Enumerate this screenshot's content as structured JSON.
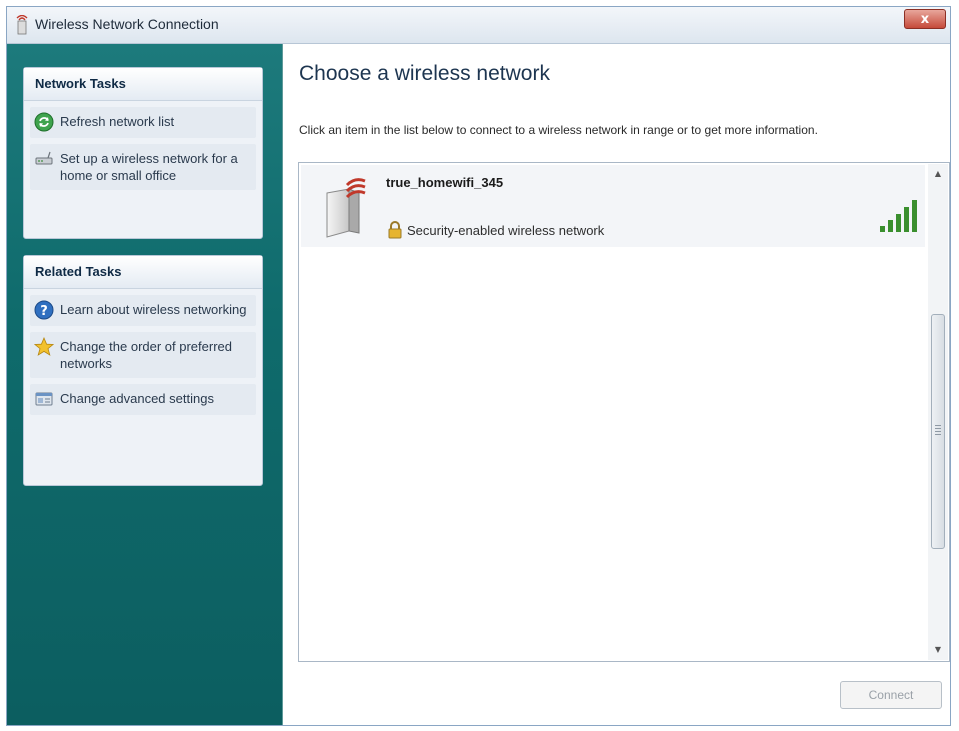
{
  "window": {
    "title": "Wireless Network Connection",
    "close_label": "x"
  },
  "sidebar": {
    "network_tasks": {
      "header": "Network Tasks",
      "items": [
        {
          "label": "Refresh network list",
          "icon": "refresh-icon"
        },
        {
          "label": "Set up a wireless network for a home or small office",
          "icon": "router-setup-icon"
        }
      ]
    },
    "related_tasks": {
      "header": "Related Tasks",
      "items": [
        {
          "label": "Learn about wireless networking",
          "icon": "help-icon"
        },
        {
          "label": "Change the order of preferred networks",
          "icon": "star-icon"
        },
        {
          "label": "Change advanced settings",
          "icon": "settings-icon"
        }
      ]
    }
  },
  "main": {
    "heading": "Choose a wireless network",
    "instructions": "Click an item in the list below to connect to a wireless network in range or to get more information.",
    "networks": [
      {
        "name": "true_homewifi_345",
        "security": "Security-enabled wireless network",
        "signal_bars": 5
      }
    ],
    "connect_label": "Connect"
  },
  "colors": {
    "sidebar": "#0f6b6c",
    "close_button": "#c54a3a",
    "signal": "#3a8f2e"
  }
}
